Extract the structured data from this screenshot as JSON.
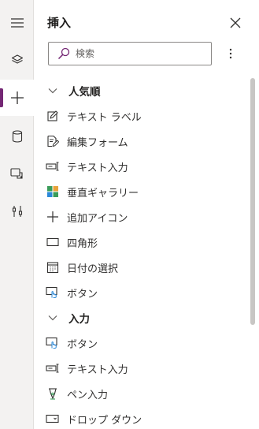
{
  "panel": {
    "title": "挿入",
    "close_icon": "close-icon",
    "more_icon": "more-vertical-icon"
  },
  "search": {
    "placeholder": "検索",
    "value": "",
    "icon": "search-icon"
  },
  "rail": {
    "items": [
      {
        "icon": "hamburger-icon",
        "active": false
      },
      {
        "icon": "layers-icon",
        "active": false
      },
      {
        "icon": "plus-icon",
        "active": true
      },
      {
        "icon": "database-icon",
        "active": false
      },
      {
        "icon": "media-icon",
        "active": false
      },
      {
        "icon": "tools-icon",
        "active": false
      }
    ]
  },
  "sections": [
    {
      "label": "人気順",
      "expanded": true,
      "items": [
        {
          "label": "テキスト ラベル",
          "icon": "edit-label-icon"
        },
        {
          "label": "編集フォーム",
          "icon": "edit-form-icon"
        },
        {
          "label": "テキスト入力",
          "icon": "text-input-icon"
        },
        {
          "label": "垂直ギャラリー",
          "icon": "gallery-icon"
        },
        {
          "label": "追加アイコン",
          "icon": "add-icon"
        },
        {
          "label": "四角形",
          "icon": "rectangle-icon"
        },
        {
          "label": "日付の選択",
          "icon": "calendar-icon"
        },
        {
          "label": "ボタン",
          "icon": "button-icon"
        }
      ]
    },
    {
      "label": "入力",
      "expanded": true,
      "items": [
        {
          "label": "ボタン",
          "icon": "button-icon"
        },
        {
          "label": "テキスト入力",
          "icon": "text-input-icon"
        },
        {
          "label": "ペン入力",
          "icon": "pen-icon"
        },
        {
          "label": "ドロップ ダウン",
          "icon": "dropdown-icon"
        }
      ]
    }
  ],
  "colors": {
    "accent": "#742774",
    "gallery_green": "#3a9c5a",
    "gallery_orange": "#e8a23a",
    "gallery_blue": "#2b88d8"
  }
}
